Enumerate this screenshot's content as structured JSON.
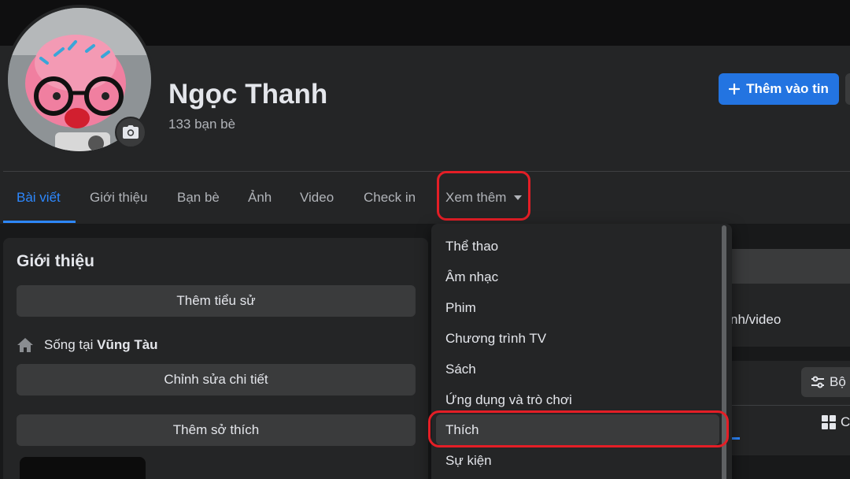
{
  "profile": {
    "name": "Ngọc Thanh",
    "friends": "133 bạn bè"
  },
  "header": {
    "add_story_label": "Thêm vào tin"
  },
  "tabs": [
    {
      "label": "Bài viết",
      "active": true
    },
    {
      "label": "Giới thiệu"
    },
    {
      "label": "Bạn bè"
    },
    {
      "label": "Ảnh"
    },
    {
      "label": "Video"
    },
    {
      "label": "Check in"
    },
    {
      "label": "Xem thêm"
    }
  ],
  "intro": {
    "title": "Giới thiệu",
    "add_bio_label": "Thêm tiểu sử",
    "lives_in_prefix": "Sống tại",
    "lives_in_city": "Vũng Tàu",
    "edit_details_label": "Chỉnh sửa chi tiết",
    "add_hobbies_label": "Thêm sở thích"
  },
  "dropdown": {
    "items": [
      "Thể thao",
      "Âm nhạc",
      "Phim",
      "Chương trình TV",
      "Sách",
      "Ứng dụng và trò chơi",
      "Thích",
      "Sự kiện"
    ],
    "highlighted": "Thích"
  },
  "right_panel": {
    "photo_video_fragment": "nh/video",
    "filter_fragment": "Bộ",
    "grid_fragment": "C"
  },
  "colors": {
    "accent": "#2d88ff",
    "highlight_border": "#e41e26",
    "background": "#18191a",
    "card": "#242526"
  },
  "icons": [
    "camera-icon",
    "plus-icon",
    "dropdown-caret-icon",
    "home-icon",
    "filter-icon",
    "grid-icon"
  ]
}
